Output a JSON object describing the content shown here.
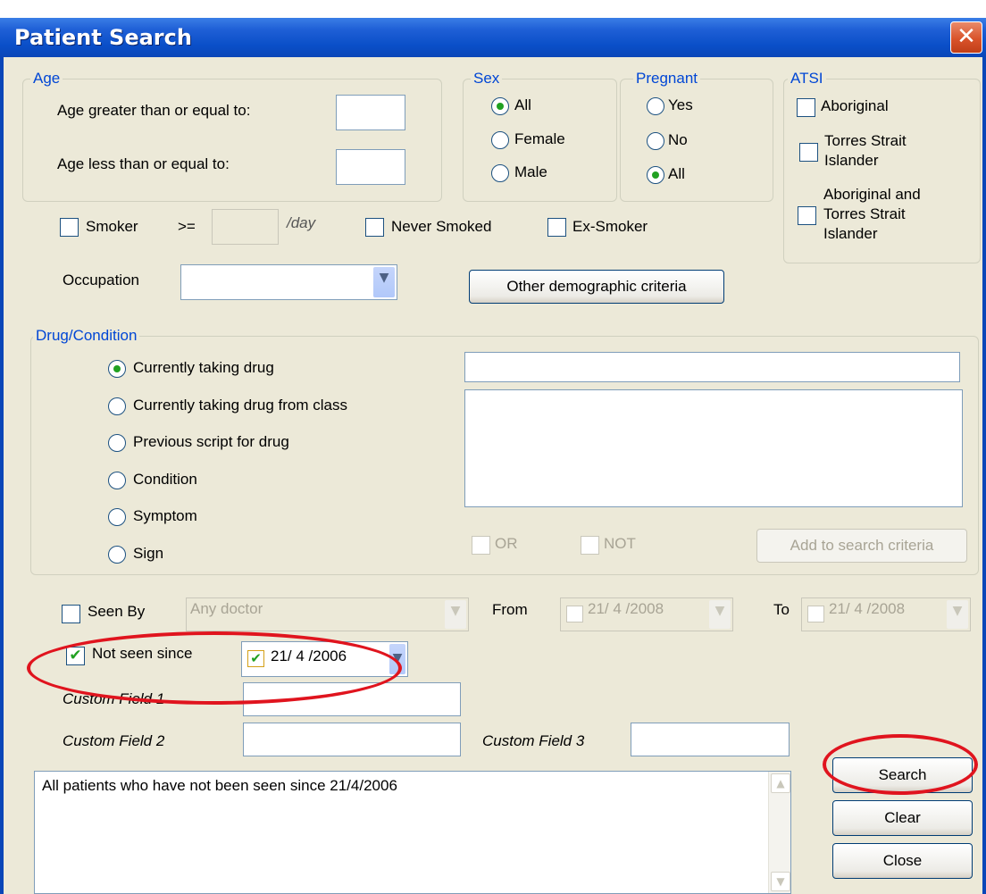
{
  "window": {
    "title": "Patient Search",
    "close_glyph": "✕"
  },
  "age": {
    "group_label": "Age",
    "gte_label": "Age greater than or equal to:",
    "lte_label": "Age less than or equal to:",
    "gte_value": "",
    "lte_value": ""
  },
  "sex": {
    "group_label": "Sex",
    "options": [
      "All",
      "Female",
      "Male"
    ],
    "selected": "All"
  },
  "pregnant": {
    "group_label": "Pregnant",
    "options": [
      "Yes",
      "No",
      "All"
    ],
    "selected": "All"
  },
  "atsi": {
    "group_label": "ATSI",
    "opt1": "Aboriginal",
    "opt2_line1": "Torres Strait",
    "opt2_line2": "Islander",
    "opt3_line1": "Aboriginal and",
    "opt3_line2": "Torres Strait",
    "opt3_line3": "Islander"
  },
  "smoking": {
    "smoker_label": "Smoker",
    "gte_symbol": ">=",
    "per_day": "/day",
    "never_label": "Never Smoked",
    "ex_label": "Ex-Smoker"
  },
  "occupation": {
    "label": "Occupation",
    "value": ""
  },
  "other_demo_button": "Other demographic criteria",
  "drug": {
    "group_label": "Drug/Condition",
    "options": [
      "Currently taking drug",
      "Currently taking drug from class",
      "Previous script for drug",
      "Condition",
      "Symptom",
      "Sign"
    ],
    "selected": "Currently taking drug",
    "or_label": "OR",
    "not_label": "NOT",
    "add_button": "Add to search criteria"
  },
  "seen_by": {
    "label": "Seen By",
    "doctor_value": "Any doctor",
    "from_label": "From",
    "from_date": "21/ 4 /2008",
    "to_label": "To",
    "to_date": "21/ 4 /2008"
  },
  "not_seen": {
    "label": "Not seen since",
    "checked": true,
    "date": "21/ 4 /2006"
  },
  "custom": {
    "field1": "Custom Field 1",
    "field2": "Custom Field 2",
    "field3": "Custom Field 3"
  },
  "summary_text": "All patients who have not been seen since 21/4/2006",
  "buttons": {
    "search": "Search",
    "clear": "Clear",
    "close": "Close"
  },
  "colors": {
    "title_bar": "#0a46b8",
    "group_label": "#0046d5",
    "highlight_ring": "#e0141e",
    "check_mark": "#21a121"
  }
}
